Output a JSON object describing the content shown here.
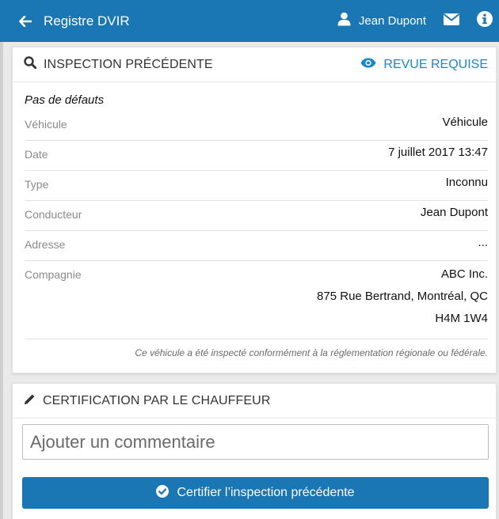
{
  "header": {
    "title": "Registre DVIR",
    "user_name": "Jean Dupont",
    "back_icon": "arrow-left-icon",
    "user_icon": "user-icon",
    "mail_icon": "envelope-icon",
    "info_icon": "info-icon",
    "bg_color": "#1b77b3"
  },
  "inspection": {
    "title": "INSPECTION PRÉCÉDENTE",
    "title_icon": "search-icon",
    "review_label": "REVUE REQUISE",
    "review_icon": "eye-icon",
    "review_color": "#1b87c9",
    "status": "Pas de défauts",
    "rows": [
      {
        "label": "Véhicule",
        "value": "Véhicule"
      },
      {
        "label": "Date",
        "value": "7 juillet 2017 13:47"
      },
      {
        "label": "Type",
        "value": "Inconnu"
      },
      {
        "label": "Conducteur",
        "value": "Jean Dupont"
      },
      {
        "label": "Adresse",
        "value": "..."
      }
    ],
    "company": {
      "label": "Compagnie",
      "lines": [
        "ABC Inc.",
        "875 Rue Bertrand, Montréal, QC",
        "H4M 1W4"
      ]
    },
    "compliance_note": "Ce véhicule a été inspecté conformément à la réglementation régionale ou fédérale."
  },
  "certification": {
    "title": "CERTIFICATION PAR LE CHAUFFEUR",
    "title_icon": "pencil-icon",
    "comment_placeholder": "Ajouter un commentaire",
    "certify_label": "Certifier l’inspection précédente",
    "certify_icon": "check-circle-icon"
  }
}
